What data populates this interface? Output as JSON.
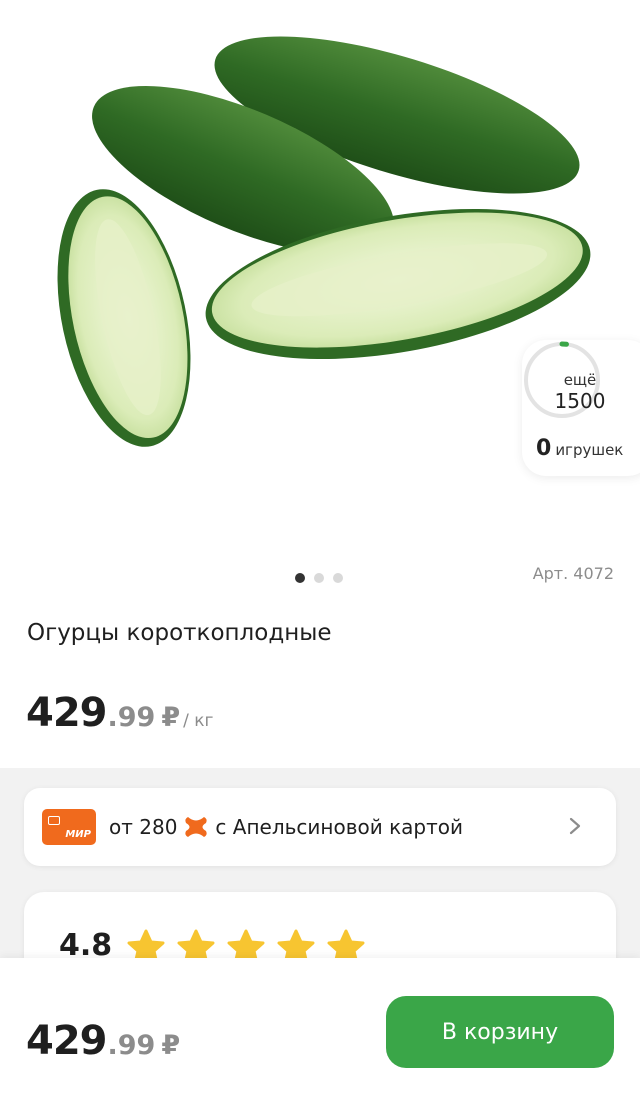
{
  "product": {
    "image_alt": "cucumbers",
    "article": "Арт. 4072",
    "title": "Огурцы короткоплодные",
    "price_whole": "429",
    "price_fraction": ".99",
    "currency": "₽",
    "unit": "/ кг",
    "gallery_count": 3,
    "gallery_active": 0
  },
  "toys_widget": {
    "more_label": "ещё",
    "target": "1500",
    "count": "0",
    "count_label": "игрушек",
    "progress": 0.02
  },
  "promo": {
    "card_label": "МИР",
    "text_before": "от 280",
    "bonus_icon": "orange-x-icon",
    "text_after": "с Апельсиновой картой"
  },
  "rating": {
    "value": "4.8",
    "stars": 5
  },
  "bottom_bar": {
    "price_whole": "429",
    "price_fraction": ".99",
    "currency": "₽",
    "cart_button": "В корзину"
  },
  "colors": {
    "accent_green": "#3aa648",
    "orange": "#f06a1d",
    "star_yellow": "#f7c531"
  }
}
